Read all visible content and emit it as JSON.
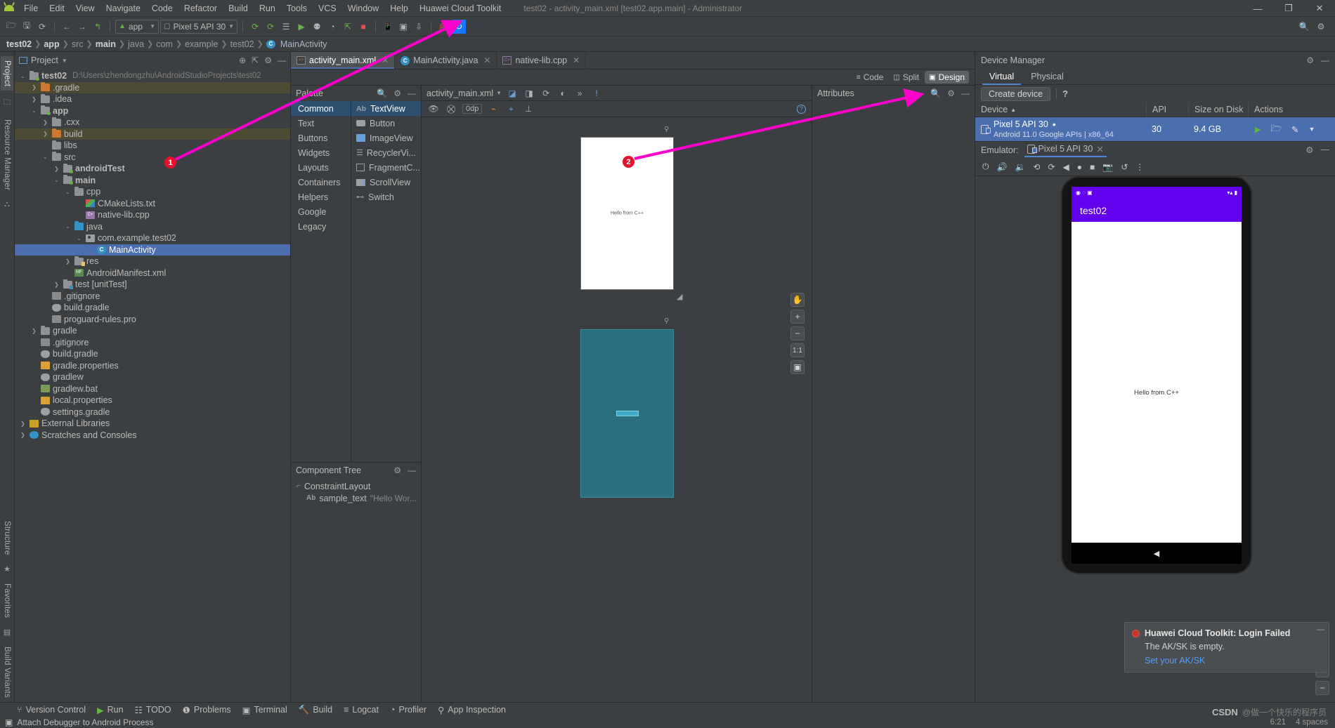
{
  "window": {
    "title": "test02 - activity_main.xml [test02.app.main] - Administrator",
    "minimize": "—",
    "maximize": "❐",
    "close": "✕"
  },
  "menubar": {
    "items": [
      "File",
      "Edit",
      "View",
      "Navigate",
      "Code",
      "Refactor",
      "Build",
      "Run",
      "Tools",
      "VCS",
      "Window",
      "Help",
      "Huawei Cloud Toolkit"
    ]
  },
  "toolbar": {
    "module_selector": "app",
    "device_selector": "Pixel 5 API 30",
    "icons": [
      "open-folder-icon",
      "save-icon",
      "sync-icon",
      "back-arrow-icon",
      "forward-arrow-icon",
      "undo-icon",
      "make-project-icon",
      "make-module-icon",
      "apply-changes-icon",
      "run-icon",
      "debug-icon",
      "profile-icon",
      "attach-debugger-icon",
      "stop-icon",
      "avd-manager-icon",
      "sdk-manager-icon",
      "device-file-explorer-icon",
      "huawei-device-icon",
      "huawei-cloud-icon"
    ],
    "search_icon": "search-icon",
    "settings_icon": "gear-icon"
  },
  "breadcrumb": {
    "items": [
      "test02",
      "app",
      "src",
      "main",
      "java",
      "com",
      "example",
      "test02",
      "MainActivity"
    ]
  },
  "left_strip": {
    "tabs": [
      "Project",
      "Resource Manager"
    ],
    "bottom_tabs": [
      "Structure",
      "Favorites",
      "Build Variants"
    ]
  },
  "project_panel": {
    "title": "Project",
    "caret": "▾",
    "actions": [
      "target-icon",
      "collapse-all-icon",
      "gear-icon",
      "hide-icon"
    ],
    "tree": [
      {
        "depth": 0,
        "arrow": "v",
        "label": "test02",
        "bold": true,
        "path": "D:\\Users\\zhendongzhu\\AndroidStudioProjects\\test02",
        "icon": "module-folder"
      },
      {
        "depth": 1,
        "arrow": ">",
        "label": ".gradle",
        "icon": "folder-orange",
        "highlight": true
      },
      {
        "depth": 1,
        "arrow": ">",
        "label": ".idea",
        "icon": "folder"
      },
      {
        "depth": 1,
        "arrow": "v",
        "label": "app",
        "bold": true,
        "icon": "module-folder"
      },
      {
        "depth": 2,
        "arrow": ">",
        "label": ".cxx",
        "icon": "folder"
      },
      {
        "depth": 2,
        "arrow": ">",
        "label": "build",
        "icon": "folder-orange",
        "highlight": true
      },
      {
        "depth": 2,
        "arrow": "",
        "label": "libs",
        "icon": "folder"
      },
      {
        "depth": 2,
        "arrow": "v",
        "label": "src",
        "icon": "folder"
      },
      {
        "depth": 3,
        "arrow": ">",
        "label": "androidTest",
        "bold": true,
        "icon": "module-folder"
      },
      {
        "depth": 3,
        "arrow": "v",
        "label": "main",
        "bold": true,
        "icon": "module-folder"
      },
      {
        "depth": 4,
        "arrow": "v",
        "label": "cpp",
        "icon": "folder"
      },
      {
        "depth": 5,
        "arrow": "",
        "label": "CMakeLists.txt",
        "icon": "cmake-file"
      },
      {
        "depth": 5,
        "arrow": "",
        "label": "native-lib.cpp",
        "icon": "cpp-file"
      },
      {
        "depth": 4,
        "arrow": "v",
        "label": "java",
        "icon": "folder-blue"
      },
      {
        "depth": 5,
        "arrow": "v",
        "label": "com.example.test02",
        "icon": "package"
      },
      {
        "depth": 6,
        "arrow": "",
        "label": "MainActivity",
        "icon": "java-class",
        "selected": true
      },
      {
        "depth": 4,
        "arrow": ">",
        "label": "res",
        "icon": "res-folder"
      },
      {
        "depth": 4,
        "arrow": "",
        "label": "AndroidManifest.xml",
        "icon": "manifest-file"
      },
      {
        "depth": 3,
        "arrow": ">",
        "label": "test [unitTest]",
        "icon": "module-folder-test"
      },
      {
        "depth": 2,
        "arrow": "",
        "label": ".gitignore",
        "icon": "gitignore-file"
      },
      {
        "depth": 2,
        "arrow": "",
        "label": "build.gradle",
        "icon": "gradle-file"
      },
      {
        "depth": 2,
        "arrow": "",
        "label": "proguard-rules.pro",
        "icon": "text-file"
      },
      {
        "depth": 1,
        "arrow": ">",
        "label": "gradle",
        "icon": "folder"
      },
      {
        "depth": 1,
        "arrow": "",
        "label": ".gitignore",
        "icon": "gitignore-file"
      },
      {
        "depth": 1,
        "arrow": "",
        "label": "build.gradle",
        "icon": "gradle-file"
      },
      {
        "depth": 1,
        "arrow": "",
        "label": "gradle.properties",
        "icon": "properties-file"
      },
      {
        "depth": 1,
        "arrow": "",
        "label": "gradlew",
        "icon": "gradle-file"
      },
      {
        "depth": 1,
        "arrow": "",
        "label": "gradlew.bat",
        "icon": "bat-file"
      },
      {
        "depth": 1,
        "arrow": "",
        "label": "local.properties",
        "icon": "properties-file"
      },
      {
        "depth": 1,
        "arrow": "",
        "label": "settings.gradle",
        "icon": "gradle-file"
      },
      {
        "depth": 0,
        "arrow": ">",
        "label": "External Libraries",
        "icon": "library"
      },
      {
        "depth": 0,
        "arrow": ">",
        "label": "Scratches and Consoles",
        "icon": "scratch"
      }
    ]
  },
  "editor": {
    "tabs": [
      {
        "label": "activity_main.xml",
        "icon": "xml-file-icon",
        "active": true,
        "close": "✕"
      },
      {
        "label": "MainActivity.java",
        "icon": "java-class-icon",
        "active": false,
        "close": "✕"
      },
      {
        "label": "native-lib.cpp",
        "icon": "cpp-file-icon",
        "active": false,
        "close": "✕"
      }
    ],
    "modes": [
      {
        "label": "Code",
        "icon": "code-view-icon",
        "active": false
      },
      {
        "label": "Split",
        "icon": "split-view-icon",
        "active": false
      },
      {
        "label": "Design",
        "icon": "design-view-icon",
        "active": true
      }
    ]
  },
  "palette": {
    "title": "Palette",
    "search_icon": "search-icon",
    "gear_icon": "gear-icon",
    "minimize_icon": "minimize-icon",
    "categories": [
      {
        "label": "Common",
        "active": true
      },
      {
        "label": "Text",
        "active": false
      },
      {
        "label": "Buttons",
        "active": false
      },
      {
        "label": "Widgets",
        "active": false
      },
      {
        "label": "Layouts",
        "active": false
      },
      {
        "label": "Containers",
        "active": false
      },
      {
        "label": "Helpers",
        "active": false
      },
      {
        "label": "Google",
        "active": false
      },
      {
        "label": "Legacy",
        "active": false
      }
    ],
    "items": [
      {
        "label": "TextView",
        "icon": "text-view-icon",
        "active": true
      },
      {
        "label": "Button",
        "icon": "button-icon",
        "active": false
      },
      {
        "label": "ImageView",
        "icon": "image-view-icon",
        "active": false
      },
      {
        "label": "RecyclerVi...",
        "icon": "recycler-view-icon",
        "active": false
      },
      {
        "label": "FragmentC...",
        "icon": "fragment-container-icon",
        "active": false
      },
      {
        "label": "ScrollView",
        "icon": "scroll-view-icon",
        "active": false
      },
      {
        "label": "Switch",
        "icon": "switch-icon",
        "active": false
      }
    ]
  },
  "component_tree": {
    "title": "Component Tree",
    "gear_icon": "gear-icon",
    "minimize_icon": "minimize-icon",
    "nodes": [
      {
        "depth": 0,
        "label": "ConstraintLayout",
        "icon": "constraint-layout-icon",
        "value": ""
      },
      {
        "depth": 1,
        "label": "sample_text",
        "icon": "text-view-icon",
        "value": "\"Hello Wor..."
      }
    ]
  },
  "canvas": {
    "file_selector": "activity_main.xml",
    "caret": "▾",
    "toolbar_icons": [
      "layers-icon",
      "blueprint-toggle-icon",
      "orientation-icon",
      "theme-icon",
      "language-icon",
      "overflow-icon",
      "error-icon"
    ],
    "tool_icons": [
      "eye-icon",
      "magnet-off-icon",
      "align-icon",
      "guideline-icon",
      "baseline-icon",
      "help-icon"
    ],
    "margin_value": "0dp",
    "design_surface_label": "design-preview",
    "blueprint_surface_label": "blueprint-preview",
    "sample_text": "Hello from C++",
    "zoom_buttons": [
      "pan-icon",
      "+",
      "−",
      "1:1",
      "fit-icon"
    ]
  },
  "attributes": {
    "title": "Attributes",
    "search_icon": "search-icon",
    "gear_icon": "gear-icon",
    "minimize_icon": "minimize-icon"
  },
  "device_manager": {
    "title": "Device Manager",
    "gear_icon": "gear-icon",
    "minimize_icon": "minimize-icon",
    "tabs": [
      {
        "label": "Virtual",
        "active": true
      },
      {
        "label": "Physical",
        "active": false
      }
    ],
    "create_device_label": "Create device",
    "help_label": "?",
    "columns": [
      "Device",
      "API",
      "Size on Disk",
      "Actions"
    ],
    "sort_indicator": "▲",
    "rows": [
      {
        "device": "Pixel 5 API 30",
        "running_dot": "•",
        "details": "Android 11.0 Google APIs | x86_64",
        "api": "30",
        "size_on_disk": "9.4 GB",
        "actions": [
          "run-icon",
          "folder-icon",
          "edit-icon",
          "menu-down-icon"
        ]
      }
    ]
  },
  "emulator": {
    "label": "Emulator:",
    "tab_label": "Pixel 5 API 30",
    "tab_close": "✕",
    "gear_icon": "gear-icon",
    "minimize_icon": "minimize-icon",
    "toolbar_icons": [
      "power-icon",
      "volume-up-icon",
      "volume-down-icon",
      "rotate-left-icon",
      "rotate-right-icon",
      "back-icon",
      "home-icon",
      "overview-icon",
      "screenshot-icon",
      "history-icon",
      "more-icon"
    ],
    "device_app_title": "test02",
    "device_content_text": "Hello from C++",
    "device_time": "",
    "side_buttons": [
      "+",
      "−"
    ],
    "nav_back": "◀"
  },
  "toast": {
    "icon": "huawei-error-icon",
    "title": "Huawei Cloud Toolkit: Login Failed",
    "body": "The AK/SK is empty.",
    "link": "Set your AK/SK",
    "minimize": "—"
  },
  "statusbar": {
    "items": [
      {
        "label": "Version Control",
        "icon": "branch-icon"
      },
      {
        "label": "Run",
        "icon": "run-icon"
      },
      {
        "label": "TODO",
        "icon": "todo-icon"
      },
      {
        "label": "Problems",
        "icon": "problems-icon"
      },
      {
        "label": "Terminal",
        "icon": "terminal-icon"
      },
      {
        "label": "Build",
        "icon": "build-icon"
      },
      {
        "label": "Logcat",
        "icon": "logcat-icon"
      },
      {
        "label": "Profiler",
        "icon": "profiler-icon"
      },
      {
        "label": "App Inspection",
        "icon": "app-inspection-icon"
      }
    ]
  },
  "bottombar": {
    "message": "Attach Debugger to Android Process",
    "icon": "attach-debugger-icon",
    "right_items": [
      "6:21",
      "4 spaces"
    ]
  },
  "annotations": {
    "badges": [
      {
        "number": "1"
      },
      {
        "number": "2"
      }
    ],
    "arrow_color": "#ff00cc"
  },
  "watermark": {
    "brand": "CSDN",
    "text": "@做一个快乐的程序员"
  }
}
